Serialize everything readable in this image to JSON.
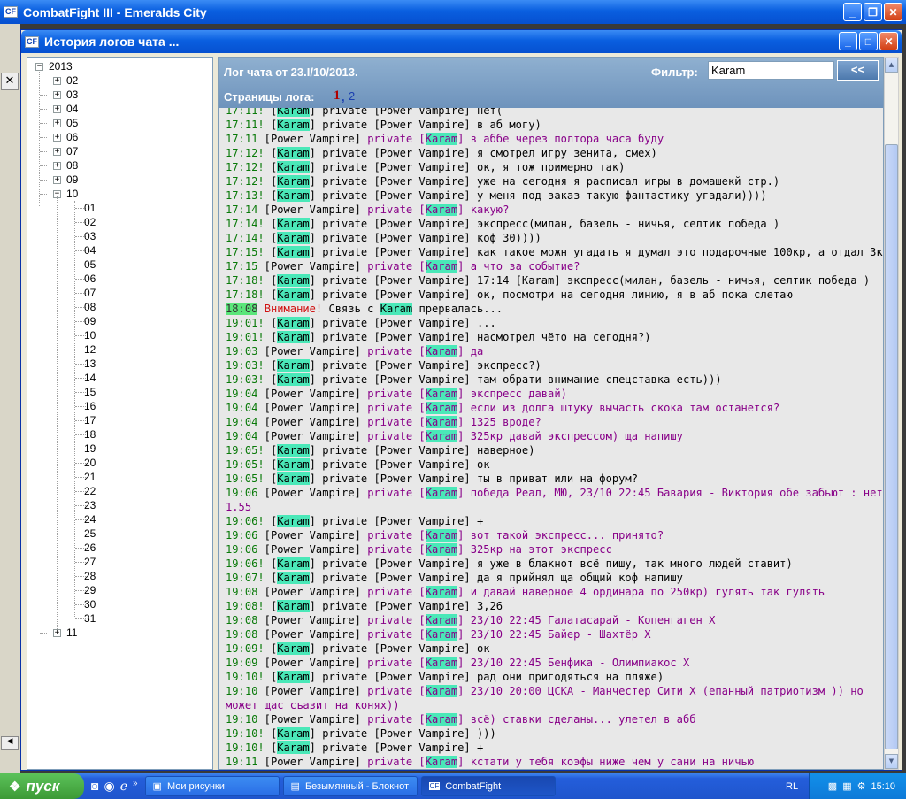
{
  "app_title": "CombatFight III - Emeralds City",
  "dialog_title": "История логов чата ...",
  "log_header": {
    "title": "Лог чата от 23.I/10/2013.",
    "filter_label": "Фильтр:",
    "filter_value": "Karam",
    "back_button": "<<",
    "pages_label": "Страницы лога:",
    "page1": "1",
    "page2": "2"
  },
  "tree": {
    "year": "2013",
    "months": [
      "02",
      "03",
      "04",
      "05",
      "06",
      "07",
      "08",
      "09",
      "10",
      "11"
    ],
    "days": [
      "01",
      "02",
      "03",
      "04",
      "05",
      "06",
      "07",
      "08",
      "09",
      "10",
      "12",
      "13",
      "14",
      "15",
      "16",
      "17",
      "18",
      "19",
      "20",
      "21",
      "22",
      "23",
      "24",
      "25",
      "26",
      "27",
      "28",
      "29",
      "30",
      "31"
    ]
  },
  "chat_lines": [
    {
      "t": "17:11!",
      "a": "Karam",
      "b": "Power Vampire",
      "m": "нет(",
      "d": "out"
    },
    {
      "t": "17:11!",
      "a": "Karam",
      "b": "Power Vampire",
      "m": "в аб могу)",
      "d": "out"
    },
    {
      "t": "17:11",
      "a": "Power Vampire",
      "b": "Karam",
      "m": "в аббе через полтора часа буду",
      "d": "in"
    },
    {
      "t": "17:12!",
      "a": "Karam",
      "b": "Power Vampire",
      "m": "я смотрел игру зенита, смех)",
      "d": "out"
    },
    {
      "t": "17:12!",
      "a": "Karam",
      "b": "Power Vampire",
      "m": "ок, я тож примерно так)",
      "d": "out"
    },
    {
      "t": "17:12!",
      "a": "Karam",
      "b": "Power Vampire",
      "m": "уже на сегодня я расписал игры в домашекй стр.)",
      "d": "out"
    },
    {
      "t": "17:13!",
      "a": "Karam",
      "b": "Power Vampire",
      "m": "у меня под заказ такую фантастику угадали))))",
      "d": "out"
    },
    {
      "t": "17:14",
      "a": "Power Vampire",
      "b": "Karam",
      "m": "какую?",
      "d": "in"
    },
    {
      "t": "17:14!",
      "a": "Karam",
      "b": "Power Vampire",
      "m": "экспресс(милан, базель - ничья, селтик победа )",
      "d": "out"
    },
    {
      "t": "17:14!",
      "a": "Karam",
      "b": "Power Vampire",
      "m": "коф 30))))",
      "d": "out"
    },
    {
      "t": "17:15!",
      "a": "Karam",
      "b": "Power Vampire",
      "m": "как такое можн угадать я думал это подарочные 100кр, а отдал 3к",
      "d": "out"
    },
    {
      "t": "17:15",
      "a": "Power Vampire",
      "b": "Karam",
      "m": "а что за событие?",
      "d": "in"
    },
    {
      "t": "17:18!",
      "a": "Karam",
      "b": "Power Vampire",
      "m": "17:14 [Karam] экспресс(милан, базель - ничья, селтик победа )",
      "d": "out"
    },
    {
      "t": "17:18!",
      "a": "Karam",
      "b": "Power Vampire",
      "m": "ок, посмотри на сегодня линию, я в аб пока слетаю",
      "d": "out"
    },
    {
      "t": "18:08",
      "warn": "Внимание!",
      "pre": "Связь с",
      "a": "Karam",
      "m": "прервалась...",
      "d": "sys"
    },
    {
      "t": "19:01!",
      "a": "Karam",
      "b": "Power Vampire",
      "m": "...",
      "d": "out"
    },
    {
      "t": "19:01!",
      "a": "Karam",
      "b": "Power Vampire",
      "m": "насмотрел чёто на сегодня?)",
      "d": "out"
    },
    {
      "t": "19:03",
      "a": "Power Vampire",
      "b": "Karam",
      "m": "да",
      "d": "in"
    },
    {
      "t": "19:03!",
      "a": "Karam",
      "b": "Power Vampire",
      "m": "экспресс?)",
      "d": "out"
    },
    {
      "t": "19:03!",
      "a": "Karam",
      "b": "Power Vampire",
      "m": "там обрати внимание спецставка есть)))",
      "d": "out"
    },
    {
      "t": "19:04",
      "a": "Power Vampire",
      "b": "Karam",
      "m": "экспресс давай)",
      "d": "in"
    },
    {
      "t": "19:04",
      "a": "Power Vampire",
      "b": "Karam",
      "m": "если из долга штуку вычасть скока там останется?",
      "d": "in"
    },
    {
      "t": "19:04",
      "a": "Power Vampire",
      "b": "Karam",
      "m": "1325 вроде?",
      "d": "in"
    },
    {
      "t": "19:04",
      "a": "Power Vampire",
      "b": "Karam",
      "m": "325кр давай экспрессом) ща напишу",
      "d": "in"
    },
    {
      "t": "19:05!",
      "a": "Karam",
      "b": "Power Vampire",
      "m": "наверное)",
      "d": "out"
    },
    {
      "t": "19:05!",
      "a": "Karam",
      "b": "Power Vampire",
      "m": "ок",
      "d": "out"
    },
    {
      "t": "19:05!",
      "a": "Karam",
      "b": "Power Vampire",
      "m": "ты в приват или на форум?",
      "d": "out"
    },
    {
      "t": "19:06",
      "a": "Power Vampire",
      "b": "Karam",
      "m": "победа Реал, МЮ, 23/10 22:45 Бавария - Виктория обе забьют : нет 1.55",
      "d": "in",
      "wrap": true
    },
    {
      "t": "19:06!",
      "a": "Karam",
      "b": "Power Vampire",
      "m": "+",
      "d": "out"
    },
    {
      "t": "19:06",
      "a": "Power Vampire",
      "b": "Karam",
      "m": "вот такой экспресс... принято?",
      "d": "in"
    },
    {
      "t": "19:06",
      "a": "Power Vampire",
      "b": "Karam",
      "m": "325кр на этот экспресс",
      "d": "in"
    },
    {
      "t": "19:06!",
      "a": "Karam",
      "b": "Power Vampire",
      "m": "я уже в блакнот всё пишу, так много людей ставит)",
      "d": "out"
    },
    {
      "t": "19:07!",
      "a": "Karam",
      "b": "Power Vampire",
      "m": "да я прийнял ща общий коф напишу",
      "d": "out"
    },
    {
      "t": "19:08",
      "a": "Power Vampire",
      "b": "Karam",
      "m": "и давай наверное 4 ординара по 250кр) гулять так гулять",
      "d": "in"
    },
    {
      "t": "19:08!",
      "a": "Karam",
      "b": "Power Vampire",
      "m": "3,26",
      "d": "out"
    },
    {
      "t": "19:08",
      "a": "Power Vampire",
      "b": "Karam",
      "m": "23/10 22:45 Галатасарай - Копенгаген Х",
      "d": "in"
    },
    {
      "t": "19:08",
      "a": "Power Vampire",
      "b": "Karam",
      "m": "23/10 22:45 Байер - Шахтёр Х",
      "d": "in"
    },
    {
      "t": "19:09!",
      "a": "Karam",
      "b": "Power Vampire",
      "m": "ок",
      "d": "out"
    },
    {
      "t": "19:09",
      "a": "Power Vampire",
      "b": "Karam",
      "m": "23/10 22:45 Бенфика - Олимпиакос Х",
      "d": "in"
    },
    {
      "t": "19:10!",
      "a": "Karam",
      "b": "Power Vampire",
      "m": "рад они пригодяться на пляже)",
      "d": "out"
    },
    {
      "t": "19:10",
      "a": "Power Vampire",
      "b": "Karam",
      "m": "23/10 20:00 ЦСКА - Манчестер Сити Х (епанный патриотизм )) но может щас съазит на конях))",
      "d": "in",
      "wrap": true
    },
    {
      "t": "19:10",
      "a": "Power Vampire",
      "b": "Karam",
      "m": "всё) ставки сделаны... улетел в абб",
      "d": "in"
    },
    {
      "t": "19:10!",
      "a": "Karam",
      "b": "Power Vampire",
      "m": ")))",
      "d": "out"
    },
    {
      "t": "19:10!",
      "a": "Karam",
      "b": "Power Vampire",
      "m": "+",
      "d": "out"
    },
    {
      "t": "19:11",
      "a": "Power Vampire",
      "b": "Karam",
      "m": "кстати у тебя коэфы ниже чем у сани на ничью",
      "d": "in"
    }
  ],
  "private_word": "private",
  "taskbar": {
    "start": "пуск",
    "tasks": [
      "Мои рисунки",
      "Безымянный - Блокнот",
      "CombatFight"
    ],
    "lang": "RL",
    "clock": "15:10"
  }
}
